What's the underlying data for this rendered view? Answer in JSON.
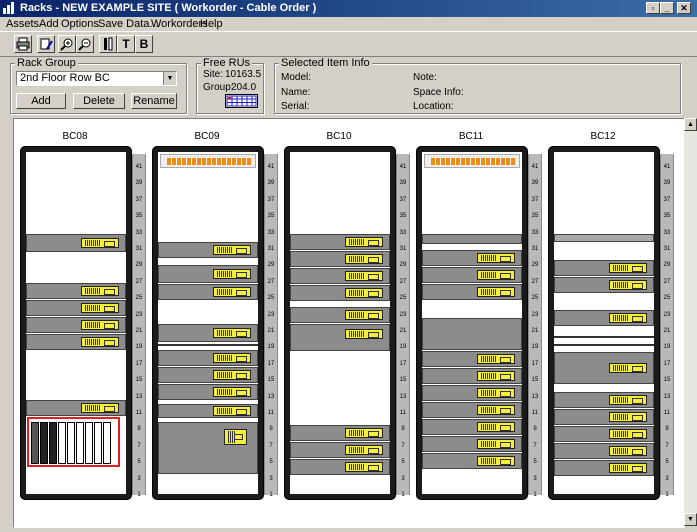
{
  "window": {
    "title": "Racks - NEW EXAMPLE SITE  ( Workorder - Cable Order )",
    "controls": [
      "restore-icon",
      "minimize-icon",
      "close-icon"
    ]
  },
  "menu": [
    "Assets",
    "Add",
    "Options",
    "Save Data...",
    "Workorders",
    "Help"
  ],
  "toolbar": {
    "buttons": [
      "print-icon",
      "edit-icon",
      "zoom-in-icon",
      "zoom-out-icon",
      "rack-layout-icon",
      "T",
      "B"
    ]
  },
  "rack_group": {
    "label": "Rack Group",
    "selected": "2nd Floor Row BC",
    "add_label": "Add",
    "delete_label": "Delete",
    "rename_label": "Rename"
  },
  "free_rus": {
    "label": "Free RUs",
    "site_label": "Site:",
    "site_value": "10163.5",
    "group_label": "Group:",
    "group_value": "204.0"
  },
  "selected_item": {
    "label": "Selected Item Info",
    "model_label": "Model:",
    "name_label": "Name:",
    "serial_label": "Serial:",
    "note_label": "Note:",
    "space_label": "Space Info:",
    "location_label": "Location:"
  },
  "racks": [
    {
      "name": "BC08"
    },
    {
      "name": "BC09"
    },
    {
      "name": "BC10"
    },
    {
      "name": "BC11"
    },
    {
      "name": "BC12"
    }
  ],
  "ru_labels": [
    "41",
    "39",
    "37",
    "35",
    "33",
    "31",
    "29",
    "27",
    "25",
    "23",
    "21",
    "19",
    "17",
    "15",
    "13",
    "11",
    "9",
    "7",
    "5",
    "3",
    "1"
  ],
  "colors": {
    "titlebar": "#0a246a",
    "device": "#8c8c8c",
    "device_tag": "#f4ee3c",
    "patch_panel": "#f28a16",
    "selection": "#e02020"
  }
}
